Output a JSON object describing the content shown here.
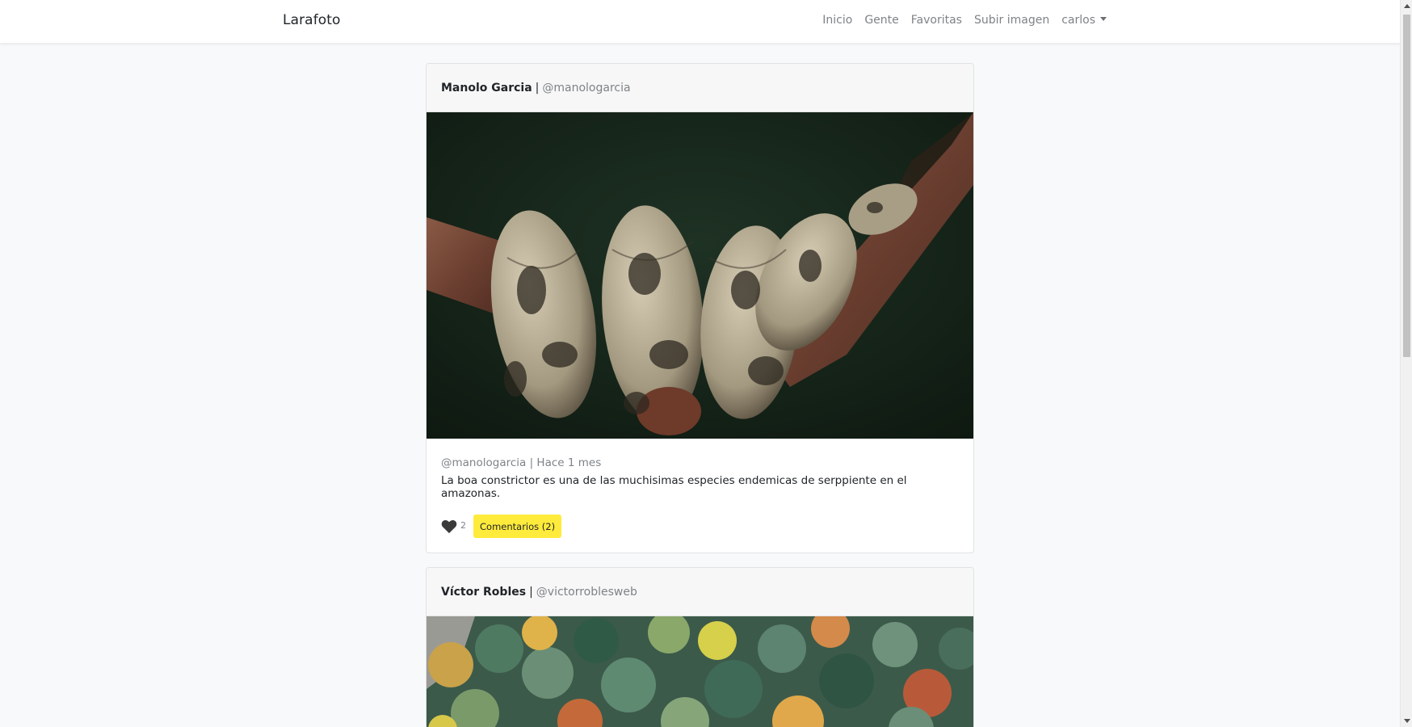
{
  "navbar": {
    "brand": "Larafoto",
    "links": [
      "Inicio",
      "Gente",
      "Favoritas",
      "Subir imagen"
    ],
    "user": "carlos"
  },
  "posts": [
    {
      "author_name": "Manolo Garcia",
      "separator": "|",
      "author_nick": "@manologarcia",
      "image_subject": "boa constrictor coiled on a branch",
      "meta": "@manologarcia | Hace 1 mes",
      "description": "La boa constrictor es una de las muchisimas especies endemicas de serppiente en el amazonas.",
      "likes": "2",
      "comments_label": "Comentarios (2)"
    },
    {
      "author_name": "Víctor Robles",
      "separator": "|",
      "author_nick": "@victorroblesweb",
      "image_subject": "autumn forest treetops on a hillside"
    }
  ],
  "colors": {
    "comments_button": "#ffeb3b",
    "page_background": "#f8f9fa",
    "heart": "#3a3a3a"
  },
  "icons": [
    "heart-icon",
    "caret-down-icon"
  ]
}
